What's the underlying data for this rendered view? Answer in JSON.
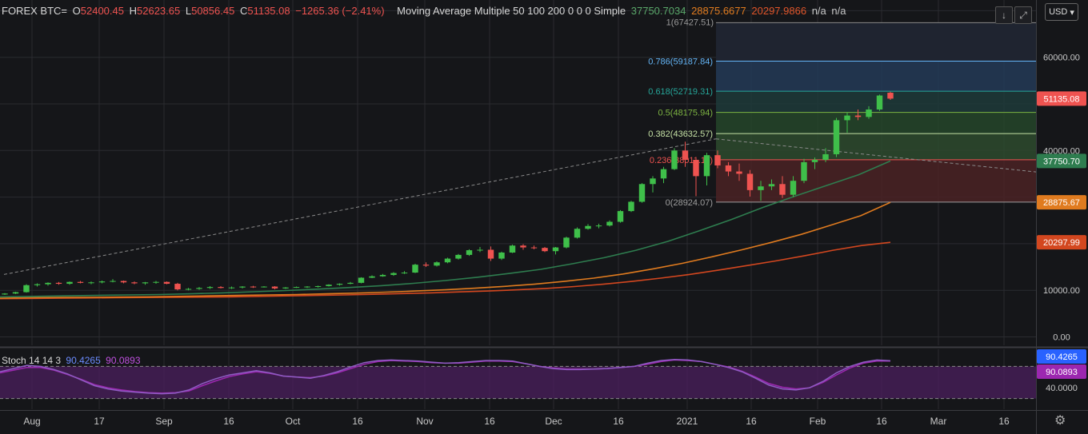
{
  "header": {
    "symbol": "FOREX BTC=",
    "open_label": "O",
    "open": "52400.45",
    "high_label": "H",
    "high": "52623.65",
    "low_label": "L",
    "low": "50856.45",
    "close_label": "C",
    "close": "51135.08",
    "change": "−1265.36 (−2.41%)",
    "indicator_name": "Moving Average Multiple 50 100 200 0 0 0 Simple",
    "ma1_value": "37750.7034",
    "ma2_value": "28875.6677",
    "ma3_value": "20297.9866",
    "na1": "n/a",
    "na2": "n/a",
    "currency": "USD"
  },
  "stoch": {
    "name": "Stoch 14 14 3",
    "k_value": "90.4265",
    "d_value": "90.0893"
  },
  "colors": {
    "background": "#151619",
    "up": "#26a69a",
    "up_candle": "#3fbf4a",
    "down": "#ef5350",
    "ma50": "#2e7d4f",
    "ma100": "#e07b1f",
    "ma200": "#d3471f",
    "stoch_k": "#8e5cc2",
    "stoch_d": "#9c27b0",
    "stoch_band": "#4b1f5e"
  },
  "chart_data": {
    "type": "candlestick",
    "x_tick_labels": [
      "Aug",
      "17",
      "Sep",
      "16",
      "Oct",
      "16",
      "Nov",
      "16",
      "Dec",
      "16",
      "2021",
      "16",
      "Feb",
      "16",
      "Mar",
      "16"
    ],
    "y_axis_labels": [
      "60000.00",
      "40000.00",
      "10000.00",
      "0.00"
    ],
    "price_badges": [
      {
        "label": "51135.08",
        "color": "#ef5350"
      },
      {
        "label": "37750.70",
        "color": "#2e7d4f"
      },
      {
        "label": "28875.67",
        "color": "#e07b1f"
      },
      {
        "label": "20297.99",
        "color": "#d3471f"
      }
    ],
    "stoch_axis_labels": [
      "40.0000"
    ],
    "stoch_badges": [
      {
        "label": "90.4265",
        "color": "#2962ff"
      },
      {
        "label": "90.0893",
        "color": "#9c27b0"
      }
    ],
    "fib_levels": [
      {
        "ratio": 0.786,
        "price": 59187.84,
        "label": "0.786(59187.84)",
        "color": "#64b5f6"
      },
      {
        "ratio": 0.618,
        "price": 52719.31,
        "label": "0.618(52719.31)",
        "color": "#26a69a"
      },
      {
        "ratio": 0.5,
        "price": 48175.94,
        "label": "0.5(48175.94)",
        "color": "#7cb342"
      },
      {
        "ratio": 0.382,
        "price": 43632.57,
        "label": "0.382(43632.57)",
        "color": "#c5e1a5"
      },
      {
        "ratio": 0.236,
        "price": 38011.11,
        "label": "0.236(38011.11)",
        "color": "#ef5350"
      },
      {
        "ratio": 0,
        "price": 28924.07,
        "label": "0(28924.07)",
        "color": "#9e9e9e"
      }
    ],
    "fib_top_label": "1(67427.51)",
    "candles": [
      {
        "o": 9100,
        "h": 9400,
        "l": 9000,
        "c": 9300
      },
      {
        "o": 9300,
        "h": 9700,
        "l": 9200,
        "c": 9600
      },
      {
        "o": 9600,
        "h": 11300,
        "l": 9500,
        "c": 11100
      },
      {
        "o": 11100,
        "h": 11500,
        "l": 10800,
        "c": 11300
      },
      {
        "o": 11300,
        "h": 11700,
        "l": 11000,
        "c": 11600
      },
      {
        "o": 11600,
        "h": 11800,
        "l": 11200,
        "c": 11400
      },
      {
        "o": 11400,
        "h": 11900,
        "l": 11200,
        "c": 11800
      },
      {
        "o": 11800,
        "h": 12000,
        "l": 11500,
        "c": 11600
      },
      {
        "o": 11600,
        "h": 11900,
        "l": 11300,
        "c": 11700
      },
      {
        "o": 11700,
        "h": 12100,
        "l": 11500,
        "c": 11900
      },
      {
        "o": 11900,
        "h": 12400,
        "l": 11700,
        "c": 12000
      },
      {
        "o": 12000,
        "h": 12100,
        "l": 11500,
        "c": 11700
      },
      {
        "o": 11700,
        "h": 11900,
        "l": 11300,
        "c": 11500
      },
      {
        "o": 11500,
        "h": 11800,
        "l": 11200,
        "c": 11700
      },
      {
        "o": 11700,
        "h": 12000,
        "l": 11400,
        "c": 11800
      },
      {
        "o": 11800,
        "h": 11900,
        "l": 11300,
        "c": 11400
      },
      {
        "o": 11400,
        "h": 11600,
        "l": 10000,
        "c": 10200
      },
      {
        "o": 10200,
        "h": 10500,
        "l": 10000,
        "c": 10300
      },
      {
        "o": 10300,
        "h": 10700,
        "l": 10100,
        "c": 10500
      },
      {
        "o": 10500,
        "h": 10900,
        "l": 10300,
        "c": 10700
      },
      {
        "o": 10700,
        "h": 10900,
        "l": 10400,
        "c": 10500
      },
      {
        "o": 10500,
        "h": 10800,
        "l": 10300,
        "c": 10600
      },
      {
        "o": 10600,
        "h": 10900,
        "l": 10400,
        "c": 10800
      },
      {
        "o": 10800,
        "h": 10950,
        "l": 10500,
        "c": 10700
      },
      {
        "o": 10700,
        "h": 10900,
        "l": 10600,
        "c": 10800
      },
      {
        "o": 10800,
        "h": 10900,
        "l": 10200,
        "c": 10400
      },
      {
        "o": 10400,
        "h": 10700,
        "l": 10300,
        "c": 10600
      },
      {
        "o": 10600,
        "h": 10800,
        "l": 10500,
        "c": 10700
      },
      {
        "o": 10700,
        "h": 10900,
        "l": 10500,
        "c": 10800
      },
      {
        "o": 10800,
        "h": 11000,
        "l": 10600,
        "c": 10900
      },
      {
        "o": 10900,
        "h": 11300,
        "l": 10800,
        "c": 11200
      },
      {
        "o": 11200,
        "h": 11500,
        "l": 11000,
        "c": 11400
      },
      {
        "o": 11400,
        "h": 11800,
        "l": 11300,
        "c": 11600
      },
      {
        "o": 11600,
        "h": 12800,
        "l": 11500,
        "c": 12700
      },
      {
        "o": 12700,
        "h": 13200,
        "l": 12600,
        "c": 13000
      },
      {
        "o": 13000,
        "h": 13500,
        "l": 12900,
        "c": 13300
      },
      {
        "o": 13300,
        "h": 13900,
        "l": 13100,
        "c": 13700
      },
      {
        "o": 13700,
        "h": 14100,
        "l": 13500,
        "c": 13800
      },
      {
        "o": 13800,
        "h": 15700,
        "l": 13700,
        "c": 15500
      },
      {
        "o": 15500,
        "h": 16000,
        "l": 15000,
        "c": 15300
      },
      {
        "o": 15300,
        "h": 16200,
        "l": 15100,
        "c": 16000
      },
      {
        "o": 16000,
        "h": 17000,
        "l": 15800,
        "c": 16800
      },
      {
        "o": 16800,
        "h": 17800,
        "l": 16600,
        "c": 17600
      },
      {
        "o": 17600,
        "h": 18800,
        "l": 17400,
        "c": 18600
      },
      {
        "o": 18600,
        "h": 19300,
        "l": 18200,
        "c": 18700
      },
      {
        "o": 18700,
        "h": 19400,
        "l": 16300,
        "c": 16800
      },
      {
        "o": 16800,
        "h": 18300,
        "l": 16500,
        "c": 18100
      },
      {
        "o": 18100,
        "h": 19800,
        "l": 18000,
        "c": 19600
      },
      {
        "o": 19600,
        "h": 19900,
        "l": 18700,
        "c": 19200
      },
      {
        "o": 19200,
        "h": 19600,
        "l": 18800,
        "c": 19100
      },
      {
        "o": 19100,
        "h": 19300,
        "l": 18200,
        "c": 18400
      },
      {
        "o": 18400,
        "h": 19300,
        "l": 17700,
        "c": 19200
      },
      {
        "o": 19200,
        "h": 21500,
        "l": 19000,
        "c": 21300
      },
      {
        "o": 21300,
        "h": 23500,
        "l": 21100,
        "c": 23200
      },
      {
        "o": 23200,
        "h": 24200,
        "l": 23000,
        "c": 23800
      },
      {
        "o": 23800,
        "h": 24300,
        "l": 23300,
        "c": 23900
      },
      {
        "o": 23900,
        "h": 25000,
        "l": 23700,
        "c": 24700
      },
      {
        "o": 24700,
        "h": 27200,
        "l": 24500,
        "c": 27000
      },
      {
        "o": 27000,
        "h": 29200,
        "l": 26800,
        "c": 29000
      },
      {
        "o": 29000,
        "h": 33000,
        "l": 28800,
        "c": 32800
      },
      {
        "o": 32800,
        "h": 34500,
        "l": 31000,
        "c": 34000
      },
      {
        "o": 34000,
        "h": 36500,
        "l": 33000,
        "c": 36000
      },
      {
        "o": 36000,
        "h": 40500,
        "l": 35800,
        "c": 40000
      },
      {
        "o": 40000,
        "h": 41900,
        "l": 36500,
        "c": 38000
      },
      {
        "o": 38000,
        "h": 38200,
        "l": 30200,
        "c": 34500
      },
      {
        "o": 34500,
        "h": 39500,
        "l": 32500,
        "c": 39000
      },
      {
        "o": 39000,
        "h": 40000,
        "l": 36200,
        "c": 36800
      },
      {
        "o": 36800,
        "h": 37500,
        "l": 34500,
        "c": 35500
      },
      {
        "o": 35500,
        "h": 37200,
        "l": 33500,
        "c": 35000
      },
      {
        "o": 35000,
        "h": 35800,
        "l": 30100,
        "c": 31500
      },
      {
        "o": 31500,
        "h": 33500,
        "l": 29200,
        "c": 32300
      },
      {
        "o": 32300,
        "h": 33800,
        "l": 31500,
        "c": 32800
      },
      {
        "o": 32800,
        "h": 34500,
        "l": 29800,
        "c": 30500
      },
      {
        "o": 30500,
        "h": 34500,
        "l": 30000,
        "c": 33500
      },
      {
        "o": 33500,
        "h": 38200,
        "l": 33000,
        "c": 37500
      },
      {
        "o": 37500,
        "h": 38500,
        "l": 36000,
        "c": 38000
      },
      {
        "o": 38000,
        "h": 40500,
        "l": 37500,
        "c": 39200
      },
      {
        "o": 39200,
        "h": 47000,
        "l": 38600,
        "c": 46500
      },
      {
        "o": 46500,
        "h": 48200,
        "l": 43800,
        "c": 47500
      },
      {
        "o": 47500,
        "h": 48800,
        "l": 46500,
        "c": 47200
      },
      {
        "o": 47200,
        "h": 49500,
        "l": 46800,
        "c": 48800
      },
      {
        "o": 48800,
        "h": 52000,
        "l": 48500,
        "c": 51800
      },
      {
        "o": 52400.45,
        "h": 52623.65,
        "l": 50856.45,
        "c": 51135.08
      }
    ],
    "ma50": [
      8600,
      8700,
      8800,
      8900,
      9000,
      9100,
      9250,
      9450,
      9700,
      9950,
      10250,
      10600,
      11000,
      11500,
      12100,
      12800,
      13600,
      14500,
      15700,
      17000,
      18600,
      20500,
      22800,
      25200,
      27800,
      30200,
      32500,
      34800,
      37750.7
    ],
    "ma100": [
      8300,
      8400,
      8450,
      8500,
      8550,
      8600,
      8700,
      8800,
      8900,
      9000,
      9100,
      9250,
      9400,
      9600,
      9850,
      10100,
      10450,
      10850,
      11300,
      11900,
      12600,
      13500,
      14600,
      15800,
      17200,
      18700,
      20300,
      22000,
      24000,
      26000,
      28875.67
    ],
    "ma200": [
      8200,
      8250,
      8300,
      8350,
      8400,
      8450,
      8500,
      8550,
      8600,
      8700,
      8800,
      8900,
      9000,
      9150,
      9300,
      9450,
      9650,
      9850,
      10100,
      10400,
      10800,
      11300,
      11900,
      12600,
      13400,
      14300,
      15300,
      16300,
      17400,
      18600,
      19600,
      20297.99
    ],
    "stoch_k": [
      70,
      76,
      82,
      80,
      74,
      66,
      55,
      44,
      38,
      34,
      32,
      30,
      29,
      30,
      36,
      48,
      57,
      64,
      68,
      72,
      68,
      62,
      60,
      58,
      63,
      70,
      79,
      87,
      91,
      92,
      91,
      90,
      88,
      86,
      87,
      89,
      91,
      91,
      90,
      85,
      80,
      76,
      74,
      74,
      75,
      76,
      78,
      80,
      86,
      91,
      93,
      92,
      89,
      84,
      78,
      70,
      58,
      45,
      38,
      36,
      40,
      52,
      68,
      80,
      88,
      92,
      90.43
    ],
    "stoch_d": [
      68,
      73,
      78,
      78,
      73,
      65,
      56,
      46,
      40,
      36,
      33,
      31,
      30,
      31,
      34,
      44,
      53,
      61,
      66,
      70,
      67,
      62,
      60,
      59,
      62,
      68,
      76,
      84,
      89,
      91,
      90,
      89,
      87,
      86,
      86,
      88,
      90,
      90,
      89,
      85,
      80,
      77,
      75,
      75,
      75,
      76,
      78,
      80,
      84,
      89,
      92,
      91,
      89,
      84,
      79,
      71,
      60,
      48,
      41,
      38,
      40,
      50,
      64,
      77,
      86,
      90,
      90.09
    ],
    "price_ylim": [
      -1800,
      72300
    ],
    "stoch_ylim": [
      0,
      112
    ]
  }
}
